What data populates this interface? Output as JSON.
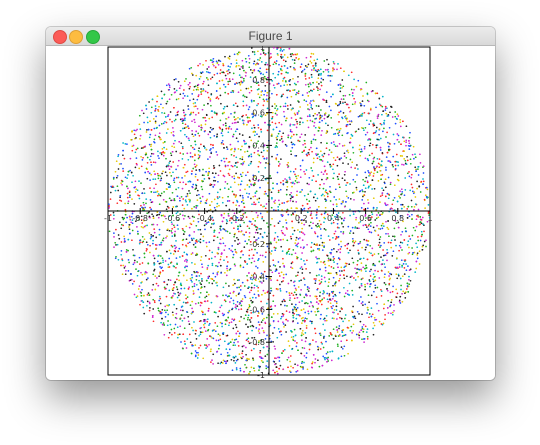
{
  "window": {
    "title": "Figure 1",
    "controls": {
      "close": "close-button",
      "minimize": "minimize-button",
      "maximize": "maximize-button"
    }
  },
  "chart_data": {
    "type": "scatter",
    "description_points": 5200,
    "xlim": [
      -1,
      1
    ],
    "ylim": [
      -1,
      1
    ],
    "grid": false,
    "legend": "none",
    "axes_through_origin": true,
    "x_ticks": [
      {
        "value": -1.0,
        "label": "-1"
      },
      {
        "value": -0.8,
        "label": "-0.8"
      },
      {
        "value": -0.6,
        "label": "-0.6"
      },
      {
        "value": -0.4,
        "label": "-0.4"
      },
      {
        "value": -0.2,
        "label": "-0.2"
      },
      {
        "value": 0.2,
        "label": "0.2"
      },
      {
        "value": 0.4,
        "label": "0.4"
      },
      {
        "value": 0.6,
        "label": "0.6"
      },
      {
        "value": 0.8,
        "label": "0.8"
      },
      {
        "value": 1.0,
        "label": "1"
      }
    ],
    "y_ticks": [
      {
        "value": 1.0,
        "label": "1"
      },
      {
        "value": 0.8,
        "label": "0.8"
      },
      {
        "value": 0.6,
        "label": "0.6"
      },
      {
        "value": 0.4,
        "label": "0.4"
      },
      {
        "value": 0.2,
        "label": "0.2"
      },
      {
        "value": -0.2,
        "label": "-0.2"
      },
      {
        "value": -0.4,
        "label": "-0.4"
      },
      {
        "value": -0.6,
        "label": "-0.6"
      },
      {
        "value": -0.8,
        "label": "-0.8"
      },
      {
        "value": -1.0,
        "label": "-1"
      }
    ],
    "point_colors": [
      "#1f4fff",
      "#ff2a2a",
      "#20b020",
      "#d024d0",
      "#00b4c8",
      "#e6c800",
      "#222222"
    ]
  }
}
